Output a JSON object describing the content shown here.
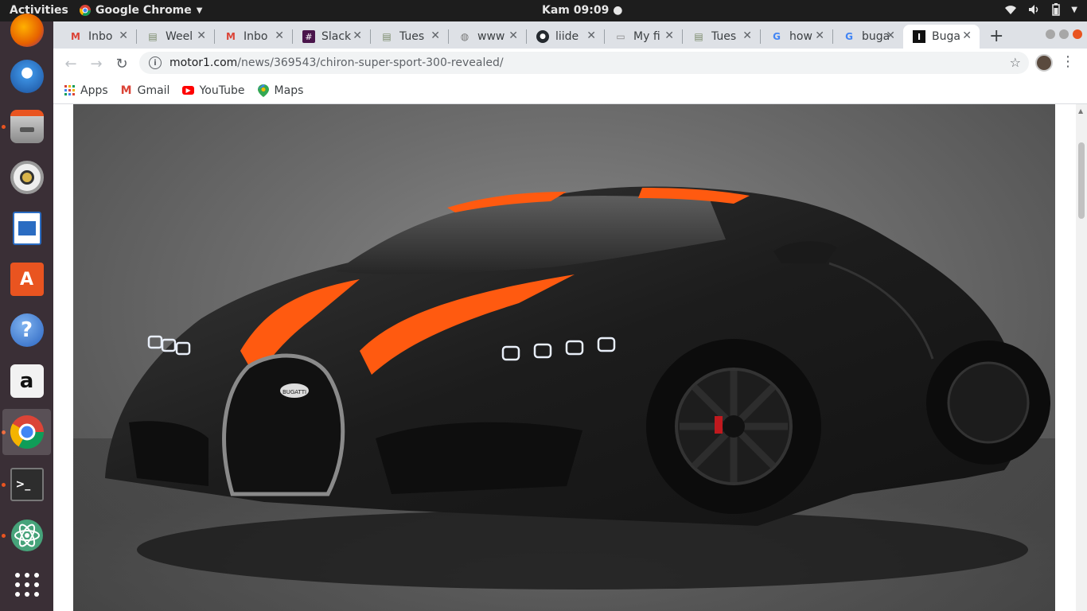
{
  "topbar": {
    "activities": "Activities",
    "app_name": "Google Chrome",
    "clock": "Kam 09:09"
  },
  "dock": {
    "items": [
      {
        "name": "firefox-icon",
        "color": "#e66000"
      },
      {
        "name": "thunderbird-icon",
        "color": "#1b6fb8"
      },
      {
        "name": "files-icon",
        "color": "#8a8a8a"
      },
      {
        "name": "rhythmbox-icon",
        "color": "#d9b44a"
      },
      {
        "name": "libreoffice-writer-icon",
        "color": "#2a6cc2"
      },
      {
        "name": "software-center-icon",
        "color": "#e95420"
      },
      {
        "name": "help-icon",
        "color": "#3b7dd8"
      },
      {
        "name": "amazon-icon",
        "color": "#f2f2f2"
      },
      {
        "name": "chrome-icon",
        "color": "#4285f4"
      },
      {
        "name": "terminal-icon",
        "color": "#2d2d2d"
      },
      {
        "name": "atom-icon",
        "color": "#46a37a"
      },
      {
        "name": "show-applications-icon",
        "color": "#ffffff"
      }
    ]
  },
  "tabs": [
    {
      "label": "Inbo",
      "icon": "gmail-icon"
    },
    {
      "label": "Weel",
      "icon": "sheet-icon"
    },
    {
      "label": "Inbo",
      "icon": "gmail-icon"
    },
    {
      "label": "Slack",
      "icon": "slack-icon"
    },
    {
      "label": "Tues",
      "icon": "sheet-icon"
    },
    {
      "label": "www",
      "icon": "globe-icon"
    },
    {
      "label": "liide",
      "icon": "github-icon"
    },
    {
      "label": "My fi",
      "icon": "doc-icon"
    },
    {
      "label": "Tues",
      "icon": "sheet-icon"
    },
    {
      "label": "how",
      "icon": "google-icon"
    },
    {
      "label": "buga",
      "icon": "google-icon"
    },
    {
      "label": "Buga",
      "icon": "motor1-icon"
    }
  ],
  "address": {
    "host": "motor1.com",
    "path": "/news/369543/chiron-super-sport-300-revealed/"
  },
  "bookmarks": [
    {
      "label": "Apps",
      "icon": "apps-grid-icon"
    },
    {
      "label": "Gmail",
      "icon": "gmail-icon"
    },
    {
      "label": "YouTube",
      "icon": "youtube-icon"
    },
    {
      "label": "Maps",
      "icon": "maps-icon"
    }
  ],
  "colors": {
    "accent_orange": "#ff5a10",
    "car_body": "#1f1f1f",
    "ubuntu_orange": "#e95420"
  },
  "hero_image": {
    "subject": "bugatti-chiron-car-icon",
    "badge_text": "BUGATTI"
  }
}
